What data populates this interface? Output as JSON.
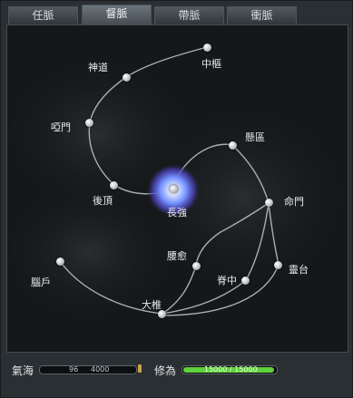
{
  "tabs": [
    {
      "label": "任脈",
      "active": false
    },
    {
      "label": "督脈",
      "active": true
    },
    {
      "label": "帶脈",
      "active": false
    },
    {
      "label": "衝脈",
      "active": false
    }
  ],
  "points": {
    "zhongshu": "中樞",
    "shendao": "神道",
    "yamen": "啞門",
    "houding": "後頂",
    "changqiang": "長強",
    "xuanshu": "懸區",
    "mingmen": "命門",
    "yaoyu": "腰愈",
    "jizhong": "脊中",
    "lingtai": "靈台",
    "naohu": "腦戶",
    "dazhui": "大椎"
  },
  "footer": {
    "qihai_label": "氣海",
    "qihai_current": "96",
    "qihai_max": "4000",
    "xiuwei_label": "修為",
    "xiuwei_text": "15000 / 15000"
  },
  "colors": {
    "accent_green": "#5fd23a",
    "core_glow": "#6f8dff"
  }
}
